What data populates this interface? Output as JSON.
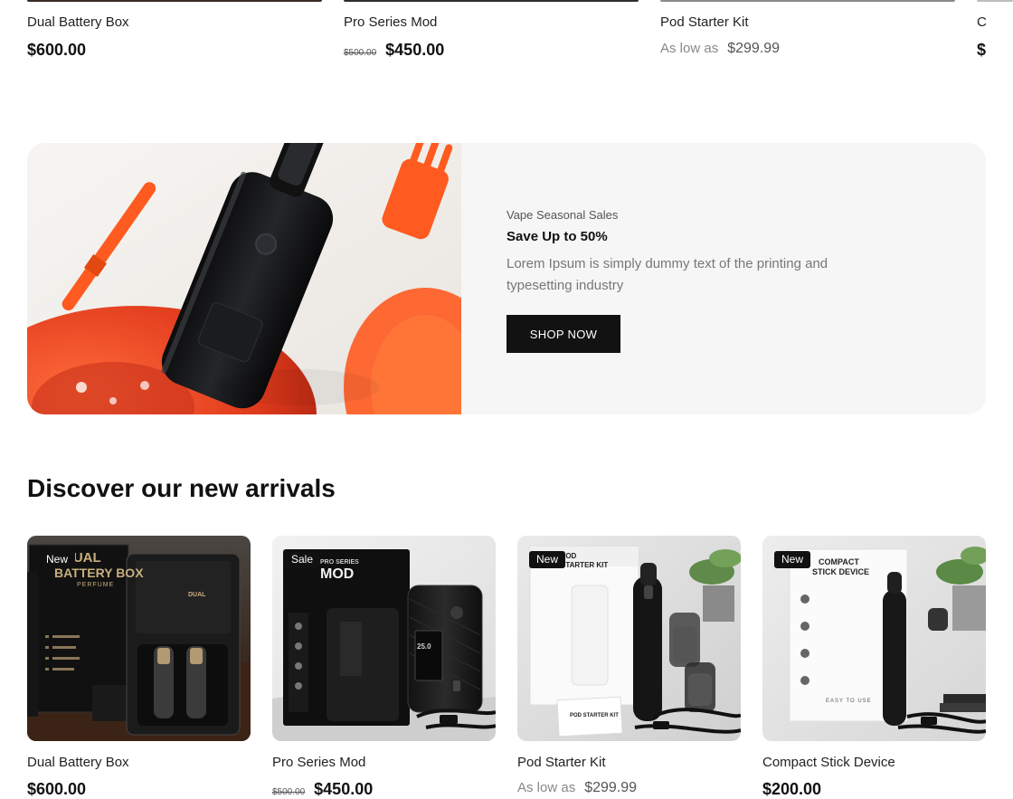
{
  "top_products": [
    {
      "title": "Dual Battery Box",
      "price": "$600.00"
    },
    {
      "title": "Pro Series Mod",
      "old_price": "$500.00",
      "price": "$450.00"
    },
    {
      "title": "Pod Starter Kit",
      "prefix": "As low as",
      "price": "$299.99"
    },
    {
      "title": "C",
      "price": "$"
    }
  ],
  "banner": {
    "eyebrow": "Vape Seasonal Sales",
    "headline": "Save Up to 50%",
    "description": "Lorem Ipsum is simply dummy text of the printing and typesetting industry",
    "button": "SHOP NOW"
  },
  "arrivals": {
    "title": "Discover our new arrivals",
    "products": [
      {
        "badge": "New",
        "title": "Dual Battery Box",
        "price": "$600.00",
        "box_text": [
          "DUAL",
          "BATTERY BOX",
          "PERFUME"
        ]
      },
      {
        "badge": "Sale",
        "title": "Pro Series Mod",
        "old_price": "$500.00",
        "price": "$450.00",
        "box_text": [
          "PRO SERIES",
          "MOD"
        ],
        "screen_text": "25.0"
      },
      {
        "badge": "New",
        "title": "Pod Starter Kit",
        "prefix": "As low as",
        "price": "$299.99",
        "box_text": [
          "POD",
          "STARTER KIT"
        ],
        "leaflet_text": "POD STARTER KIT"
      },
      {
        "badge": "New",
        "title": "Compact Stick Device",
        "price": "$200.00",
        "box_text": [
          "COMPACT",
          "STICK DEVICE"
        ],
        "box_footer": "EASY TO USE"
      }
    ]
  },
  "colors": {
    "button_bg": "#121212",
    "badge_bg": "#111111",
    "banner_bg": "#f6f6f6",
    "accent_orange": "#ff5a1f"
  }
}
